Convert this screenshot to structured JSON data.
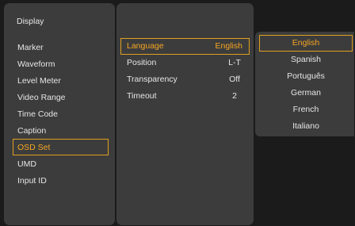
{
  "menu": {
    "title": "Display",
    "items": [
      {
        "label": "Marker"
      },
      {
        "label": "Waveform"
      },
      {
        "label": "Level Meter"
      },
      {
        "label": "Video Range"
      },
      {
        "label": "Time Code"
      },
      {
        "label": "Caption"
      },
      {
        "label": "OSD Set"
      },
      {
        "label": "UMD"
      },
      {
        "label": "Input ID"
      }
    ],
    "selected_index": 6
  },
  "osd_settings": {
    "items": [
      {
        "label": "Language",
        "value": "English"
      },
      {
        "label": "Position",
        "value": "L-T"
      },
      {
        "label": "Transparency",
        "value": "Off"
      },
      {
        "label": "Timeout",
        "value": "2"
      }
    ],
    "selected_index": 0
  },
  "language_options": {
    "items": [
      "English",
      "Spanish",
      "Português",
      "German",
      "French",
      "Italiano"
    ],
    "selected_index": 0
  },
  "colors": {
    "highlight": "#f5a623",
    "panel": "#3c3c3c",
    "background": "#1b1b1b",
    "text": "#e6e6e6"
  }
}
